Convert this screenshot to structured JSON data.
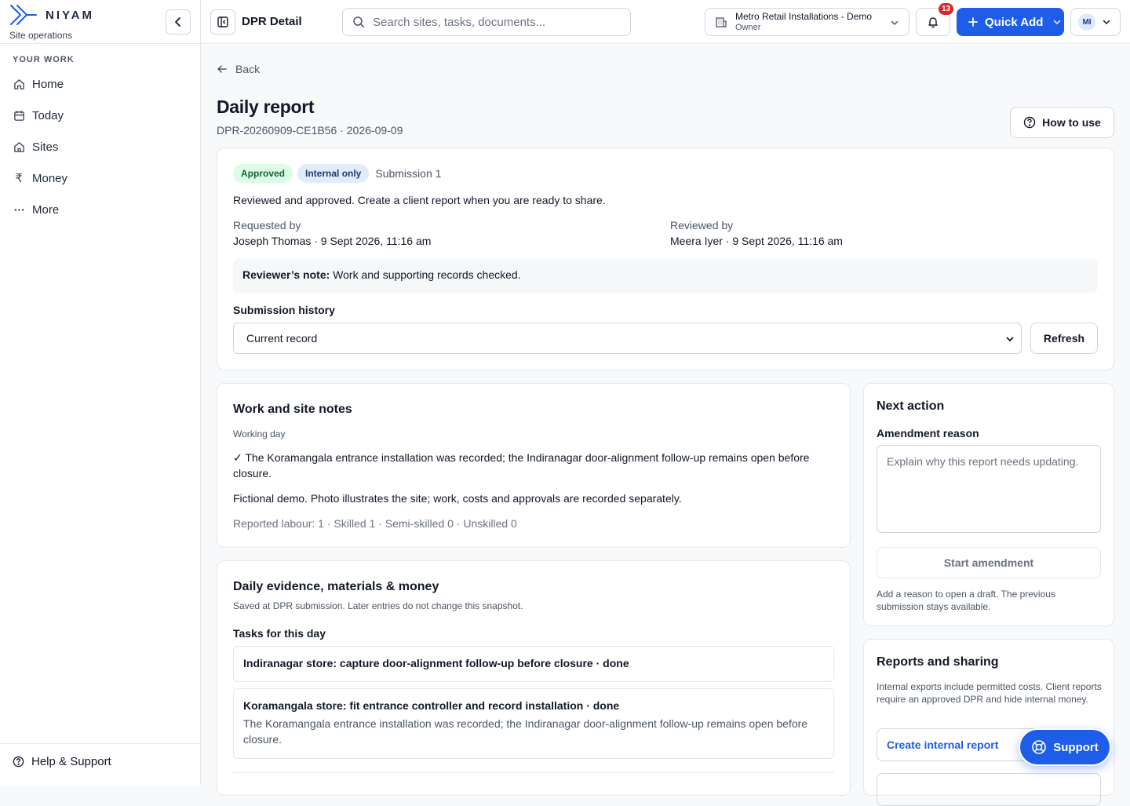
{
  "brand": {
    "name": "NIYAM",
    "subtitle": "Site operations"
  },
  "sidebar": {
    "section_label": "YOUR WORK",
    "items": [
      {
        "label": "Home",
        "icon": "home-icon"
      },
      {
        "label": "Today",
        "icon": "calendar-icon"
      },
      {
        "label": "Sites",
        "icon": "building-icon"
      },
      {
        "label": "Money",
        "icon": "rupee-icon"
      },
      {
        "label": "More",
        "icon": "more-icon"
      }
    ],
    "help_label": "Help & Support"
  },
  "topbar": {
    "title": "DPR Detail",
    "search_placeholder": "Search sites, tasks, documents...",
    "org_name": "Metro Retail Installations - Demo",
    "org_role": "Owner",
    "notification_count": "13",
    "quick_add_label": "Quick Add",
    "user_initials": "MI"
  },
  "page": {
    "back_label": "Back",
    "title": "Daily report",
    "subtitle": "DPR-20260909-CE1B56 · 2026-09-09",
    "how_to_use_label": "How to use"
  },
  "status": {
    "badge_status": "Approved",
    "badge_visibility": "Internal only",
    "submission": "Submission 1",
    "message": "Reviewed and approved. Create a client report when you are ready to share.",
    "requested_by_label": "Requested by",
    "requested_by_value": "Joseph Thomas · 9 Sept 2026, 11:16 am",
    "reviewed_by_label": "Reviewed by",
    "reviewed_by_value": "Meera Iyer · 9 Sept 2026, 11:16 am",
    "reviewer_note_label": "Reviewer’s note:",
    "reviewer_note": "Work and supporting records checked.",
    "history_label": "Submission history",
    "history_selected": "Current record",
    "refresh_label": "Refresh",
    "colors": {
      "approved_bg": "#dcfce7",
      "approved_fg": "#166534",
      "internal_bg": "#e0ecfb",
      "internal_fg": "#1e3a6e"
    }
  },
  "work_notes": {
    "title": "Work and site notes",
    "day_type": "Working day",
    "summary": "✓ The Koramangala entrance installation was recorded; the Indiranagar door-alignment follow-up remains open before closure.",
    "disclaimer": "Fictional demo. Photo illustrates the site; work, costs and approvals are recorded separately.",
    "labour": "Reported labour: 1 · Skilled 1 · Semi-skilled 0 · Unskilled 0"
  },
  "evidence": {
    "title": "Daily evidence, materials & money",
    "snapshot_note": "Saved at DPR submission. Later entries do not change this snapshot.",
    "tasks_label": "Tasks for this day",
    "tasks": [
      {
        "title": "Indiranagar store: capture door-alignment follow-up before closure · done",
        "description": ""
      },
      {
        "title": "Koramangala store: fit entrance controller and record installation · done",
        "description": "The Koramangala entrance installation was recorded; the Indiranagar door-alignment follow-up remains open before closure."
      }
    ]
  },
  "next_action": {
    "title": "Next action",
    "amendment_label": "Amendment reason",
    "amendment_placeholder": "Explain why this report needs updating.",
    "start_label": "Start amendment",
    "help_text": "Add a reason to open a draft. The previous submission stays available."
  },
  "reports": {
    "title": "Reports and sharing",
    "description": "Internal exports include permitted costs. Client reports require an approved DPR and hide internal money.",
    "create_internal_label": "Create internal report"
  },
  "support_label": "Support",
  "accent_color": "#1d5de8"
}
